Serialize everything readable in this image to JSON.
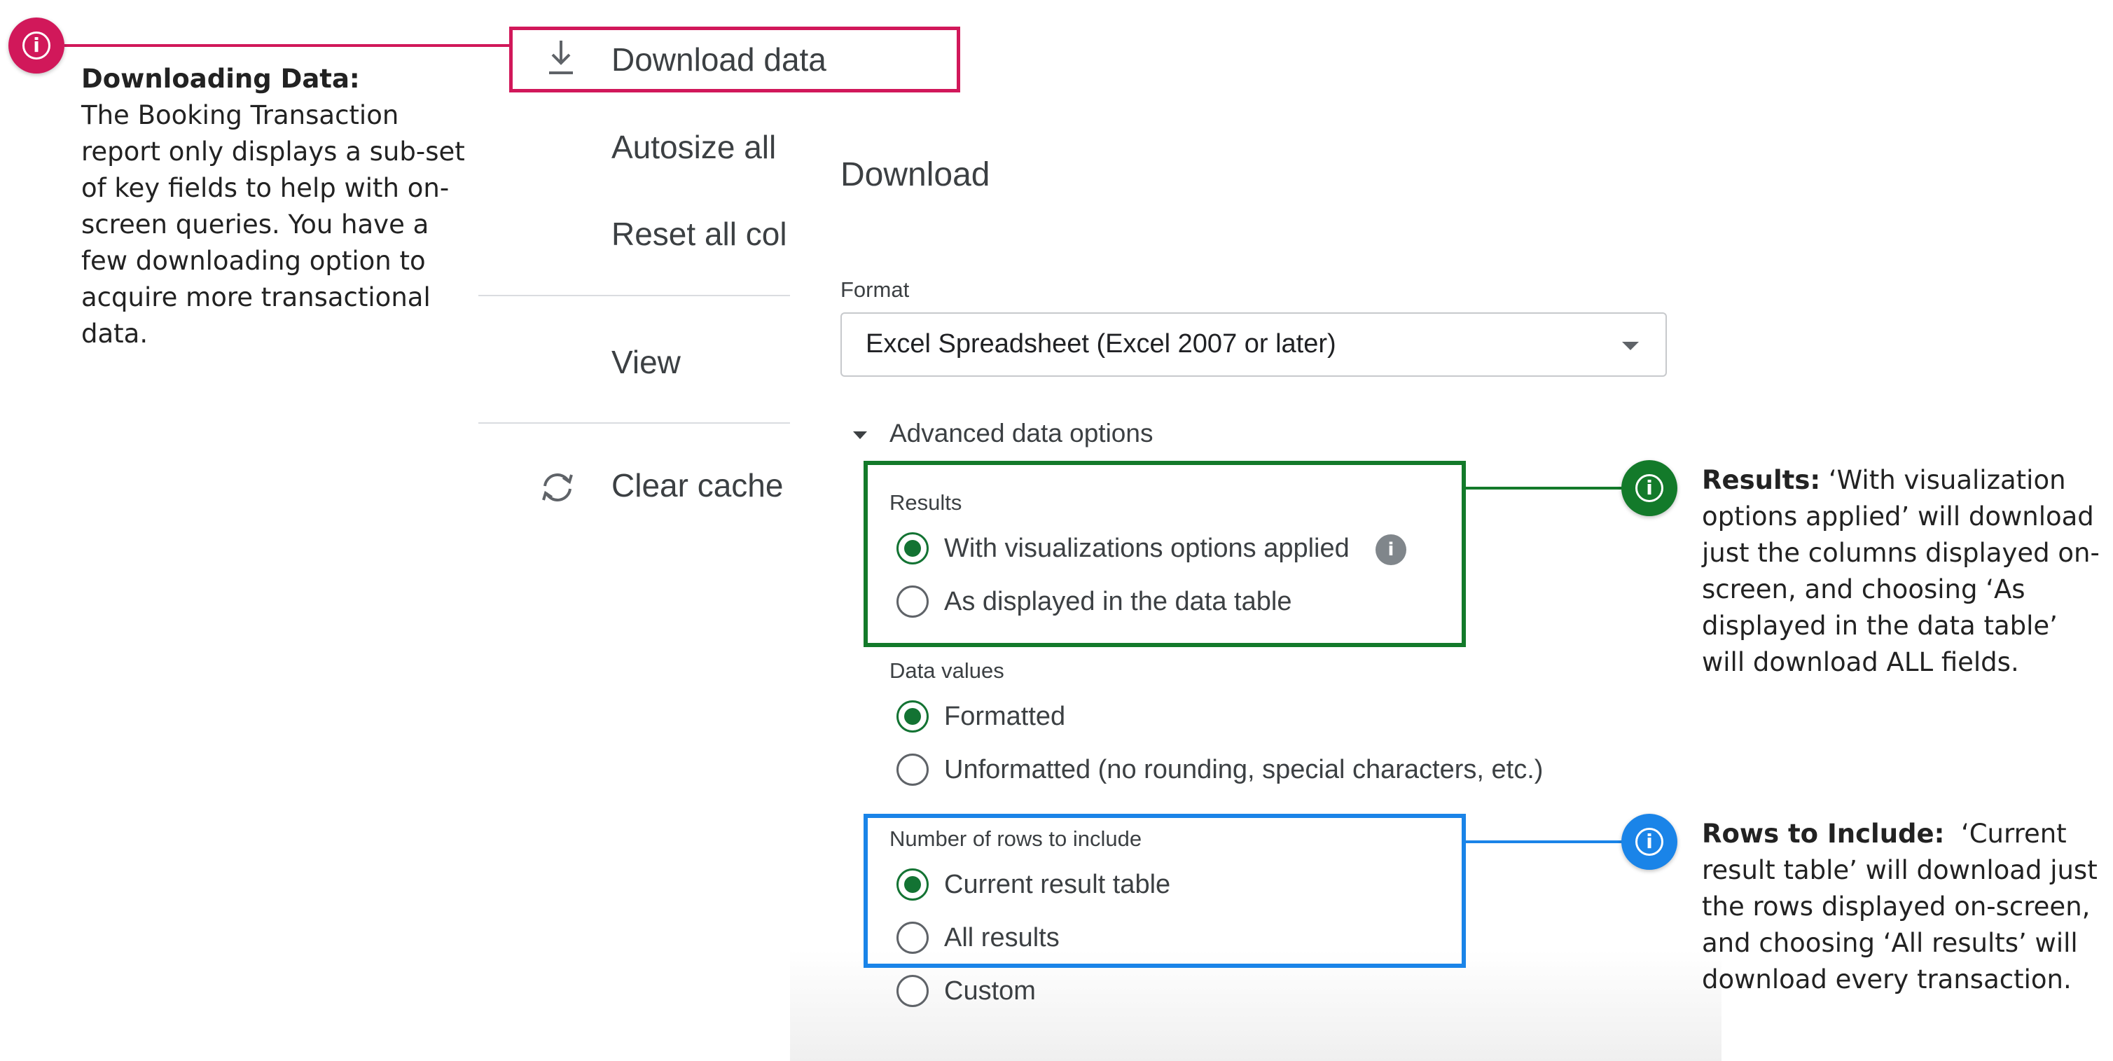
{
  "colors": {
    "pink": "#d1185a",
    "green": "#137a2a",
    "blue": "#1a84e8",
    "radio_green": "#137333"
  },
  "menu": {
    "download_data": "Download data",
    "autosize": "Autosize all",
    "reset": "Reset all col",
    "view": "View",
    "clear_cache": "Clear cache"
  },
  "dialog": {
    "title": "Download",
    "format_label": "Format",
    "format_value": "Excel Spreadsheet (Excel 2007 or later)",
    "advanced_label": "Advanced data options",
    "results_label": "Results",
    "results_options": [
      "With visualizations options applied",
      "As displayed in the data table"
    ],
    "data_values_label": "Data values",
    "data_values_options": [
      "Formatted",
      "Unformatted (no rounding, special characters, etc.)"
    ],
    "rows_label": "Number of rows to include",
    "rows_options": [
      "Current result table",
      "All results",
      "Custom"
    ]
  },
  "annotations": {
    "downloading": {
      "title": "Downloading Data:",
      "body": "The Booking Transaction report only displays a sub-set of key fields to help with on-screen queries. You have a few downloading option to acquire more transactional data."
    },
    "results": {
      "title": "Results:",
      "body": " ‘With visualization options applied’ will download just the columns displayed on-screen, and choosing ‘As displayed in the data table’ will download ALL fields."
    },
    "rows": {
      "title": "Rows to Include:",
      "body": "  ‘Current result table’ will download just the rows displayed on-screen, and choosing ‘All results’ will download every transaction."
    }
  }
}
